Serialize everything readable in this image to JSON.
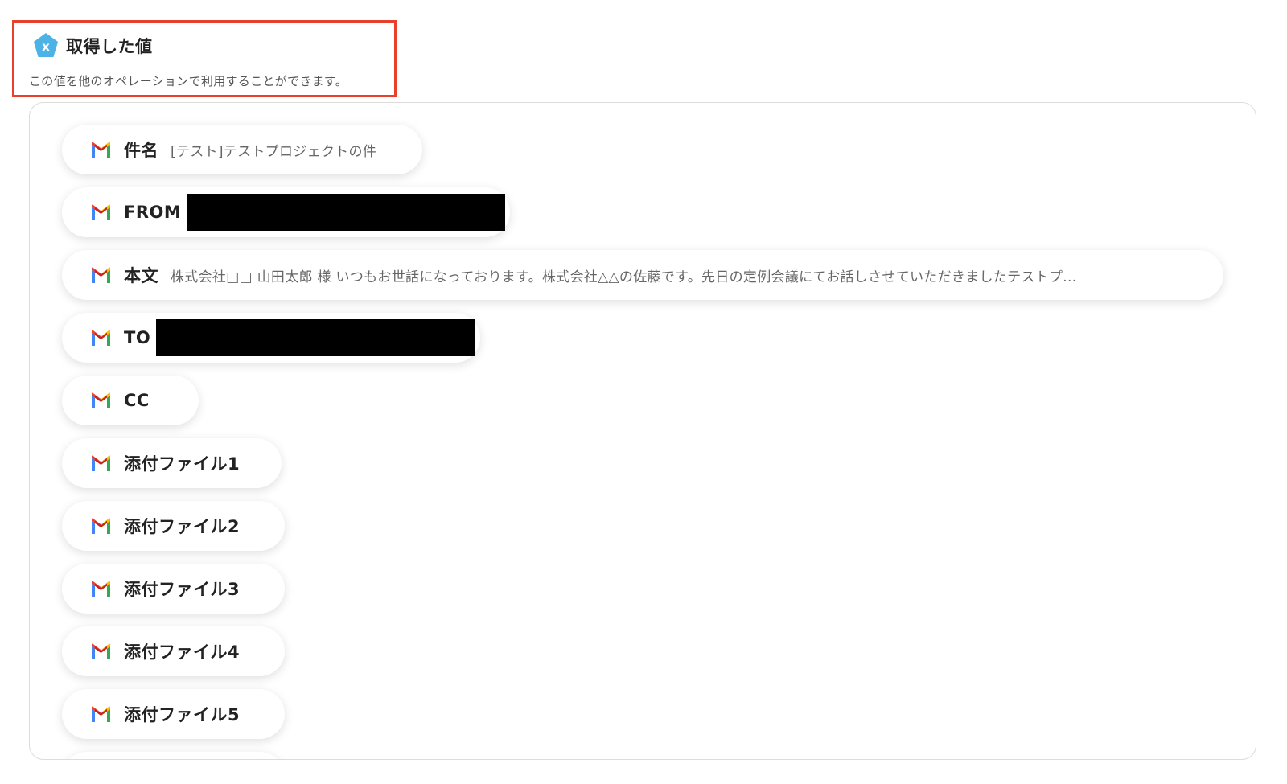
{
  "header": {
    "title": "取得した値",
    "description": "この値を他のオペレーションで利用することができます。",
    "icon": "x-variable-icon",
    "accent_color": "#4db3e6",
    "highlight_color": "#e8402a"
  },
  "fields": [
    {
      "label": "件名",
      "value": "[テスト]テストプロジェクトの件",
      "icon": "gmail-icon"
    },
    {
      "label": "FROM",
      "value": "",
      "redacted": true,
      "icon": "gmail-icon"
    },
    {
      "label": "本文",
      "value": "株式会社□□ 山田太郎 様 いつもお世話になっております。株式会社△△の佐藤です。先日の定例会議にてお話しさせていただきましたテストプ...",
      "icon": "gmail-icon"
    },
    {
      "label": "TO",
      "value": "",
      "redacted": true,
      "icon": "gmail-icon"
    },
    {
      "label": "CC",
      "value": "",
      "icon": "gmail-icon"
    },
    {
      "label": "添付ファイル1",
      "value": "",
      "icon": "gmail-icon"
    },
    {
      "label": "添付ファイル2",
      "value": "",
      "icon": "gmail-icon"
    },
    {
      "label": "添付ファイル3",
      "value": "",
      "icon": "gmail-icon"
    },
    {
      "label": "添付ファイル4",
      "value": "",
      "icon": "gmail-icon"
    },
    {
      "label": "添付ファイル5",
      "value": "",
      "icon": "gmail-icon"
    }
  ]
}
